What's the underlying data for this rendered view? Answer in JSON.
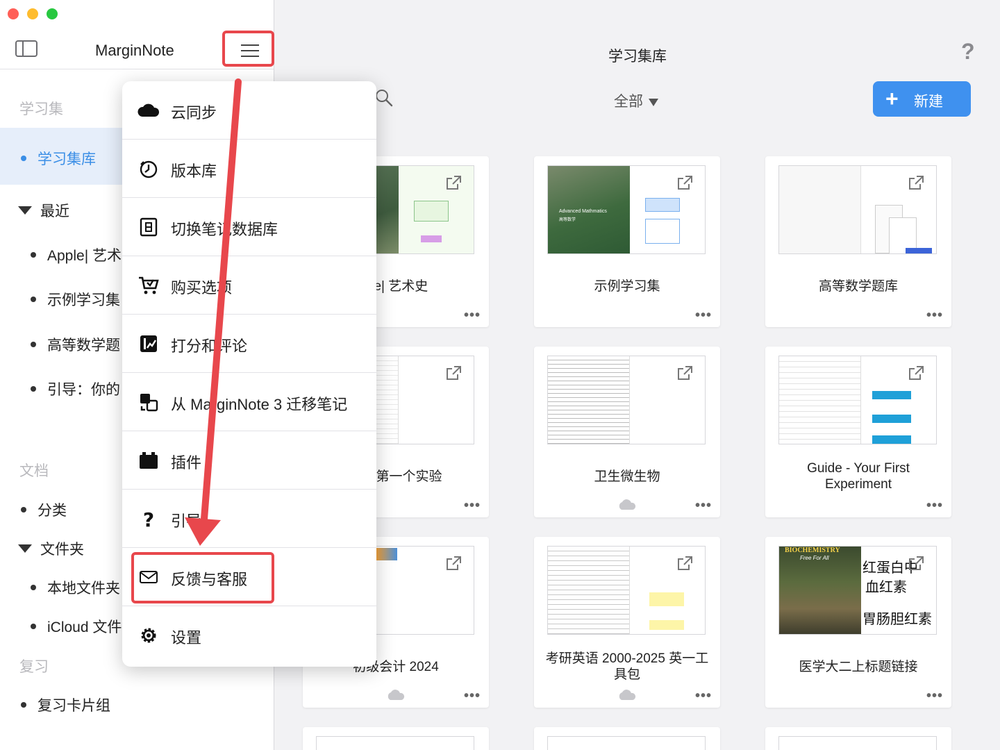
{
  "app": {
    "title": "MarginNote"
  },
  "sidebar": {
    "sections": {
      "study_sets": "学习集",
      "documents": "文档",
      "review": "复习"
    },
    "library_item": "学习集库",
    "recent_label": "最近",
    "recent_items": [
      "Apple| 艺术",
      "示例学习集",
      "高等数学题",
      "引导：你的"
    ],
    "doc_items": {
      "categories": "分类",
      "folders": "文件夹",
      "local": "本地文件夹",
      "icloud": "iCloud 文件"
    },
    "review_items": {
      "flashcards": "复习卡片组"
    }
  },
  "main": {
    "title": "学习集库",
    "filter": "全部",
    "new_button": "新建",
    "cards": [
      {
        "title": "ple| 艺术史"
      },
      {
        "title": "示例学习集"
      },
      {
        "title": "高等数学题库"
      },
      {
        "title": "你的第一个实验"
      },
      {
        "title": "卫生微生物"
      },
      {
        "title": "Guide - Your First Experiment"
      },
      {
        "title": "初级会计 2024"
      },
      {
        "title": "考研英语 2000-2025 英一工具包"
      },
      {
        "title": "医学大二上标题链接"
      }
    ],
    "thumb_texts": {
      "advanced_math": "Advanced Mathmatics",
      "advanced_math_cn": "高等数学",
      "biochem": "BIOCHEMISTRY",
      "biochem_sub": "Free For All",
      "handwriting1": "红蛋白中",
      "handwriting2": "血红素",
      "handwriting3": "胃肠胆红素"
    }
  },
  "menu": {
    "items": [
      {
        "label": "云同步",
        "icon": "cloud-icon"
      },
      {
        "label": "版本库",
        "icon": "history-icon"
      },
      {
        "label": "切换笔记数据库",
        "icon": "database-icon"
      },
      {
        "label": "购买选项",
        "icon": "cart-icon"
      },
      {
        "label": "打分和评论",
        "icon": "rating-icon"
      },
      {
        "label": "从 MarginNote 3 迁移笔记",
        "icon": "migrate-icon"
      },
      {
        "label": "插件",
        "icon": "plugin-icon"
      },
      {
        "label": "引导",
        "icon": "question-icon"
      },
      {
        "label": "反馈与客服",
        "icon": "mail-icon"
      },
      {
        "label": "设置",
        "icon": "gear-icon"
      }
    ]
  },
  "colors": {
    "accent": "#3f91ef",
    "highlight": "#e8474c",
    "selected_bg": "#e6eefa"
  }
}
